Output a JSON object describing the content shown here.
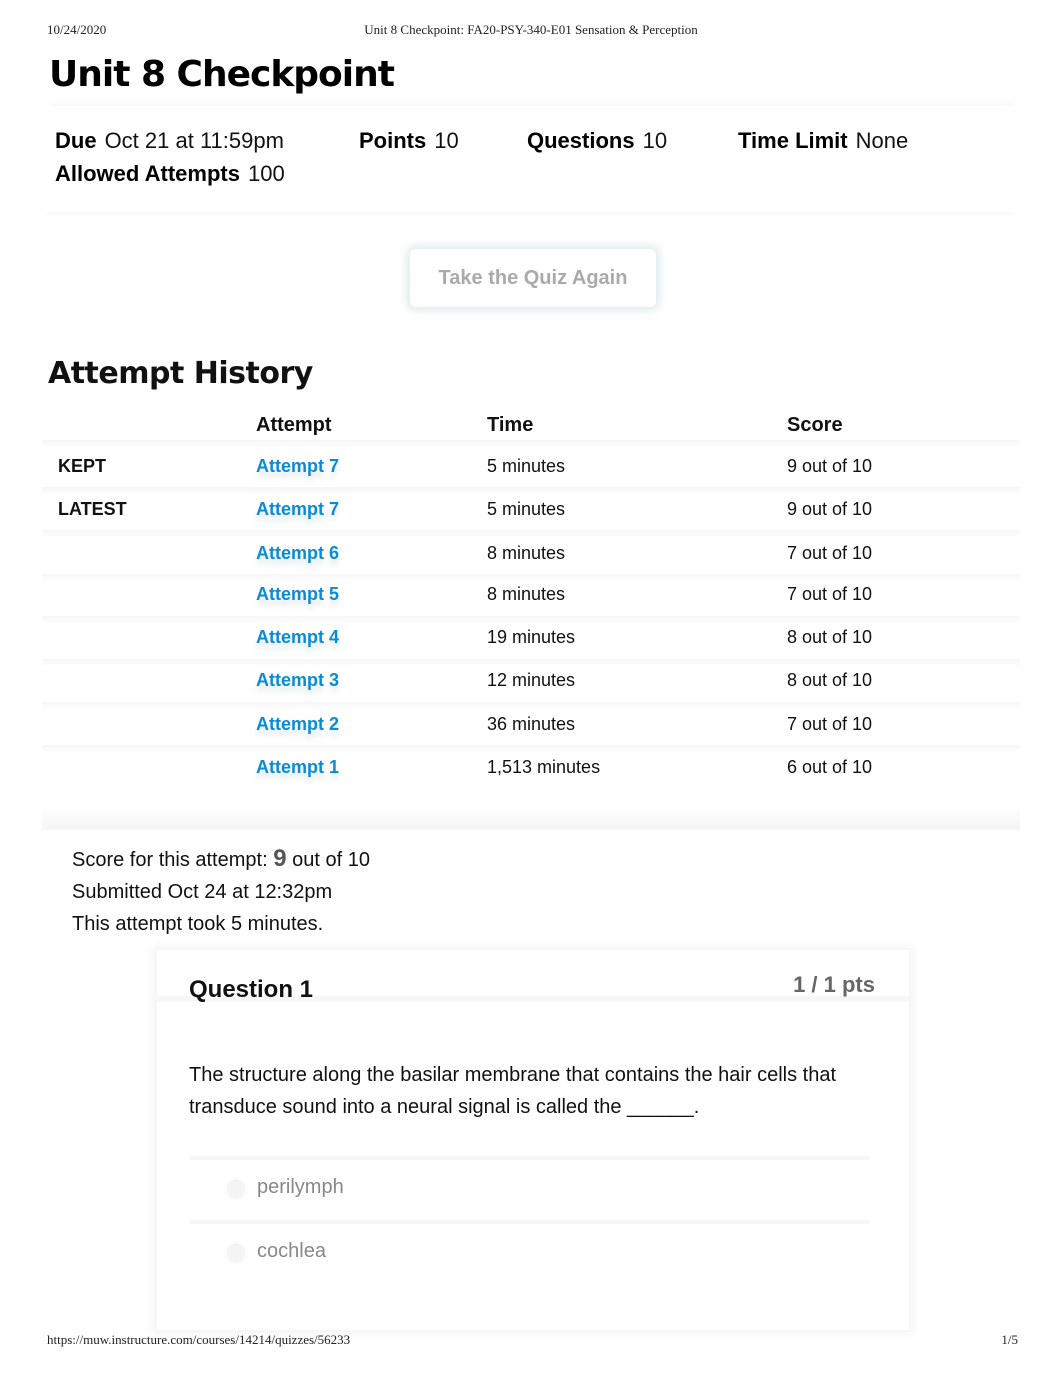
{
  "print_header": {
    "date": "10/24/2020",
    "document_title": "Unit 8 Checkpoint: FA20-PSY-340-E01 Sensation & Perception"
  },
  "page_title": "Unit 8 Checkpoint",
  "details": {
    "due_label": "Due",
    "due_value": "Oct 21 at 11:59pm",
    "points_label": "Points",
    "points_value": "10",
    "questions_label": "Questions",
    "questions_value": "10",
    "time_limit_label": "Time Limit",
    "time_limit_value": "None",
    "allowed_attempts_label": "Allowed Attempts",
    "allowed_attempts_value": "100"
  },
  "retake_button": "Take the Quiz Again",
  "attempt_history": {
    "title": "Attempt History",
    "columns": [
      "Attempt",
      "Time",
      "Score"
    ],
    "rows": [
      {
        "label": "KEPT",
        "attempt": "Attempt 7",
        "time": "5 minutes",
        "score": "9 out of 10"
      },
      {
        "label": "LATEST",
        "attempt": "Attempt 7",
        "time": "5 minutes",
        "score": "9 out of 10"
      },
      {
        "label": "",
        "attempt": "Attempt 6",
        "time": "8 minutes",
        "score": "7 out of 10"
      },
      {
        "label": "",
        "attempt": "Attempt 5",
        "time": "8 minutes",
        "score": "7 out of 10"
      },
      {
        "label": "",
        "attempt": "Attempt 4",
        "time": "19 minutes",
        "score": "8 out of 10"
      },
      {
        "label": "",
        "attempt": "Attempt 3",
        "time": "12 minutes",
        "score": "8 out of 10"
      },
      {
        "label": "",
        "attempt": "Attempt 2",
        "time": "36 minutes",
        "score": "7 out of 10"
      },
      {
        "label": "",
        "attempt": "Attempt 1",
        "time": "1,513 minutes",
        "score": "6 out of 10"
      }
    ]
  },
  "summary": {
    "score_prefix": "Score for this attempt:",
    "score_value": "9",
    "score_suffix": "out of 10",
    "submitted": "Submitted Oct 24 at 12:32pm",
    "duration": "This attempt took 5 minutes."
  },
  "question": {
    "title": "Question 1",
    "points": "1 / 1 pts",
    "text": "The structure along the basilar membrane that contains the hair cells that transduce sound into a neural signal is called the ______.",
    "answers": [
      "perilymph",
      "cochlea"
    ]
  },
  "print_footer": {
    "url": "https://muw.instructure.com/courses/14214/quizzes/56233",
    "page": "1/5"
  },
  "colors": {
    "link": "#0a8bd6",
    "text": "#111111",
    "muted": "#888888"
  }
}
